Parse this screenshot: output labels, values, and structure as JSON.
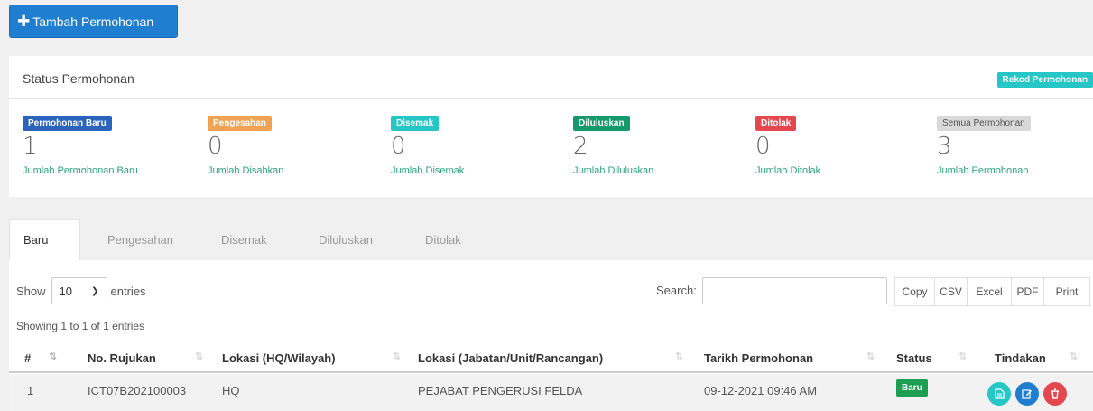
{
  "toolbar": {
    "add_label": "Tambah Permohonan"
  },
  "status": {
    "title": "Status Permohonan",
    "rekod_label": "Rekod Permohonan",
    "cards": [
      {
        "label": "Permohonan Baru",
        "count": "1",
        "caption": "Jumlah Permohonan Baru",
        "color": "#2a64bd"
      },
      {
        "label": "Pengesahan",
        "count": "0",
        "caption": "Jumlah Disahkan",
        "color": "#f0a252"
      },
      {
        "label": "Disemak",
        "count": "0",
        "caption": "Jumlah Disemak",
        "color": "#26c6c6"
      },
      {
        "label": "Diluluskan",
        "count": "2",
        "caption": "Jumlah Diluluskan",
        "color": "#159a6c"
      },
      {
        "label": "Ditolak",
        "count": "0",
        "caption": "Jumlah Ditolak",
        "color": "#e5474f"
      },
      {
        "label": "Semua Permohonan",
        "count": "3",
        "caption": "Jumlah Permohonan",
        "color": "#d9d9d9"
      }
    ]
  },
  "tabs": [
    "Baru",
    "Pengesahan",
    "Disemak",
    "Diluluskan",
    "Ditolak"
  ],
  "table_controls": {
    "show_label": "Show",
    "page_length": "10",
    "entries_label": "entries",
    "search_label": "Search:",
    "search_value": "",
    "export_buttons": [
      "Copy",
      "CSV",
      "Excel",
      "PDF",
      "Print"
    ],
    "info": "Showing 1 to 1 of 1 entries"
  },
  "table": {
    "columns": [
      "#",
      "No. Rujukan",
      "Lokasi (HQ/Wilayah)",
      "Lokasi (Jabatan/Unit/Rancangan)",
      "Tarikh Permohonan",
      "Status",
      "Tindakan"
    ],
    "rows": [
      {
        "no": "1",
        "rujukan": "ICT07B202100003",
        "lokasi_hq": "HQ",
        "lokasi_jabatan": "PEJABAT PENGERUSI FELDA",
        "tarikh": "09-12-2021 09:46 AM",
        "status": "Baru"
      }
    ]
  },
  "icons": {
    "add": "plus-icon",
    "select": "chevron-down-icon",
    "sort": "sort-icon",
    "view": "document-icon",
    "edit": "edit-icon",
    "delete": "trash-icon"
  },
  "colors": {
    "primary": "#1f7ecf",
    "teal": "#26c6c6",
    "success": "#1e9e50",
    "danger": "#e5474f",
    "link": "#2aa57c"
  }
}
